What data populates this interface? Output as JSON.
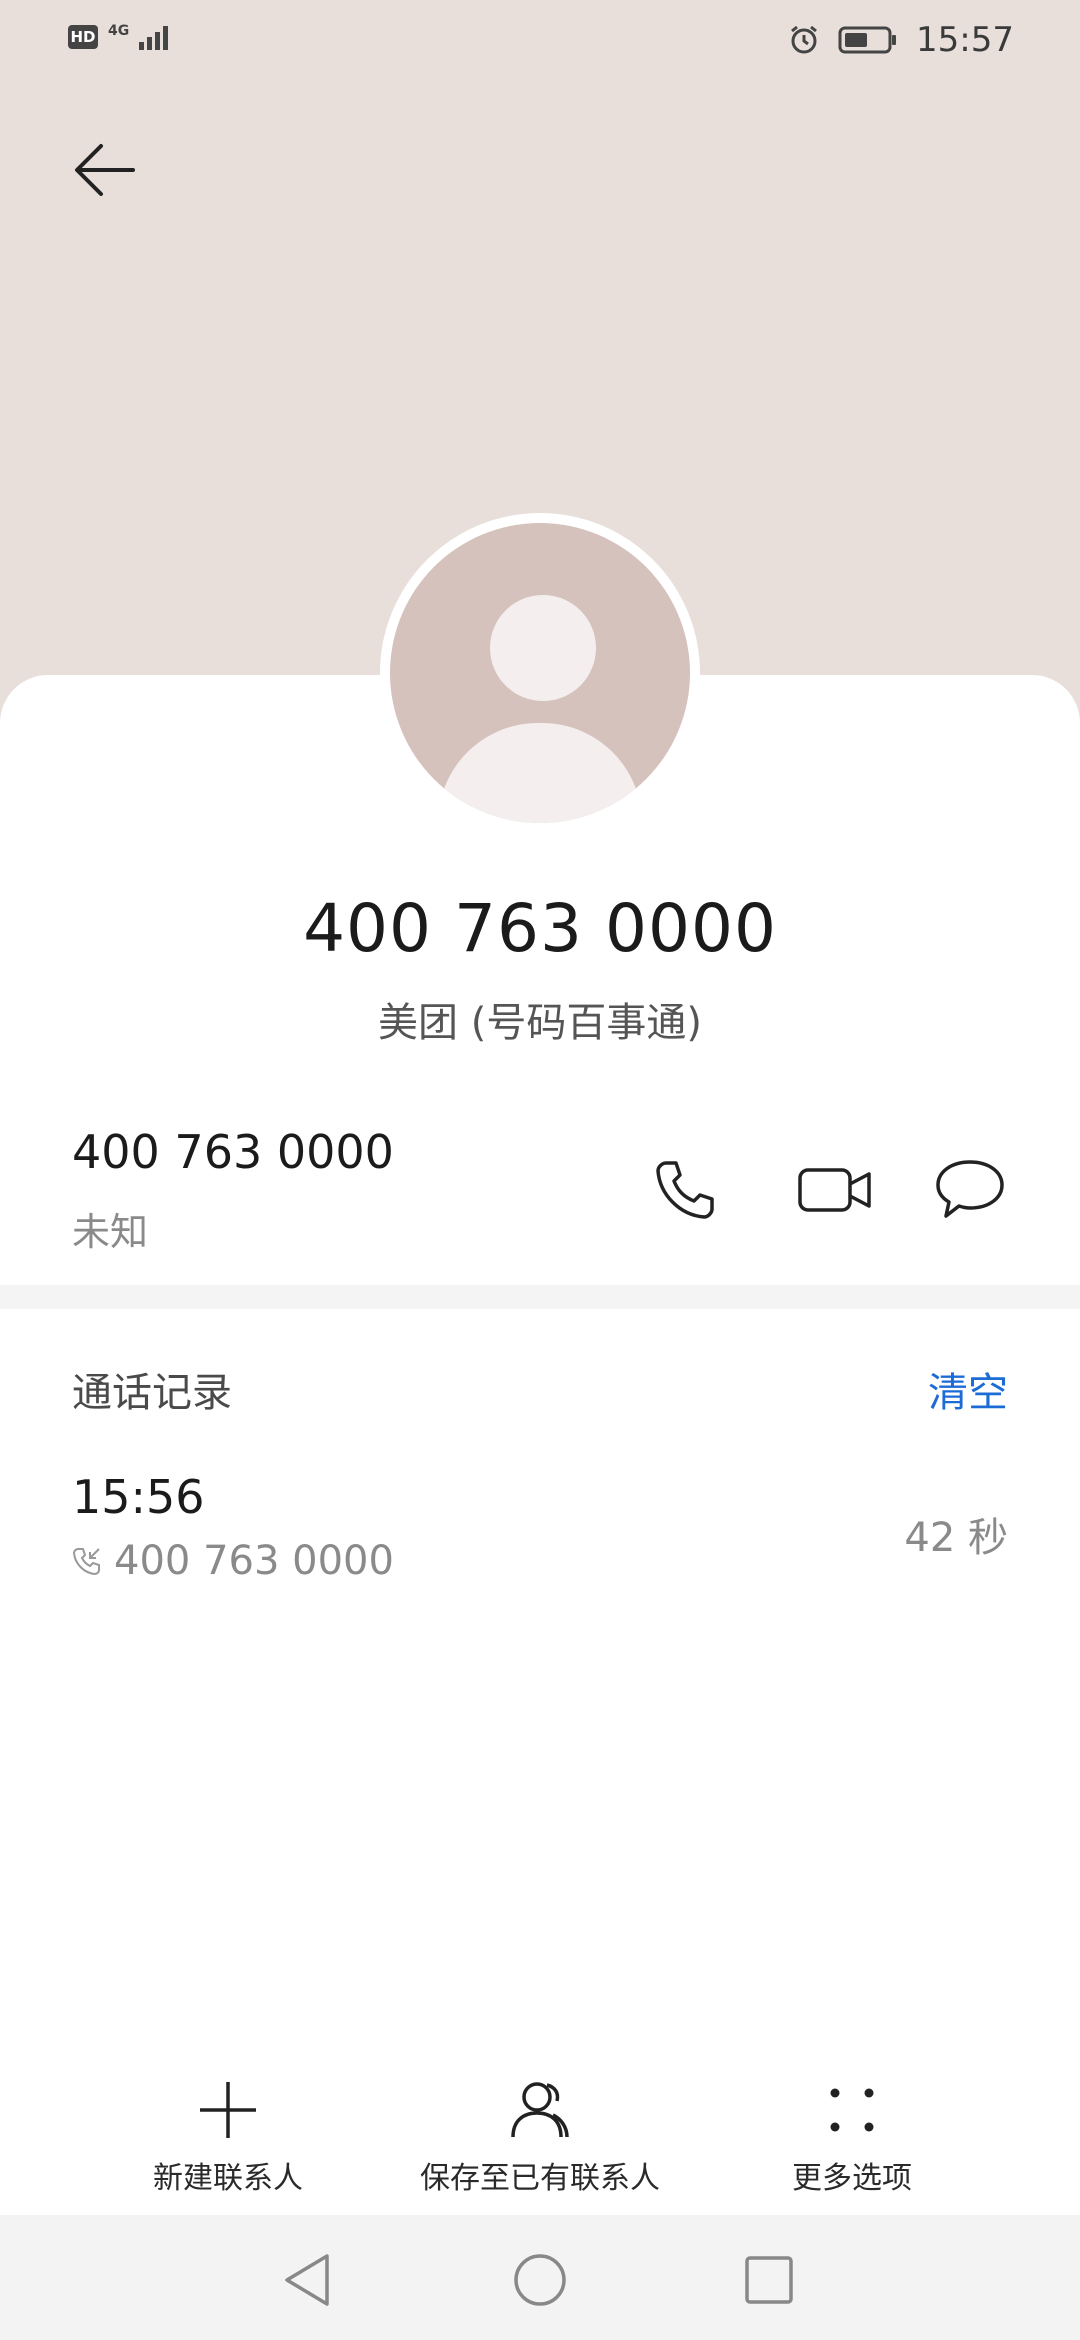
{
  "status_bar": {
    "hd": "HD",
    "network": "4G",
    "time": "15:57"
  },
  "contact": {
    "number": "400 763 0000",
    "name": "美团 (号码百事通)",
    "row_number": "400 763 0000",
    "row_type": "未知"
  },
  "call_log": {
    "title": "通话记录",
    "clear_label": "清空",
    "entries": [
      {
        "time": "15:56",
        "number": "400 763 0000",
        "duration": "42 秒"
      }
    ]
  },
  "toolbar": {
    "new_contact": "新建联系人",
    "save_existing": "保存至已有联系人",
    "more_options": "更多选项"
  },
  "icons": {
    "back": "arrow-left-icon",
    "call": "phone-icon",
    "video": "video-call-icon",
    "message": "message-icon"
  },
  "colors": {
    "header_bg": "#e8dfda",
    "avatar_bg": "#d5c2bc",
    "accent": "#1d6cd6"
  }
}
